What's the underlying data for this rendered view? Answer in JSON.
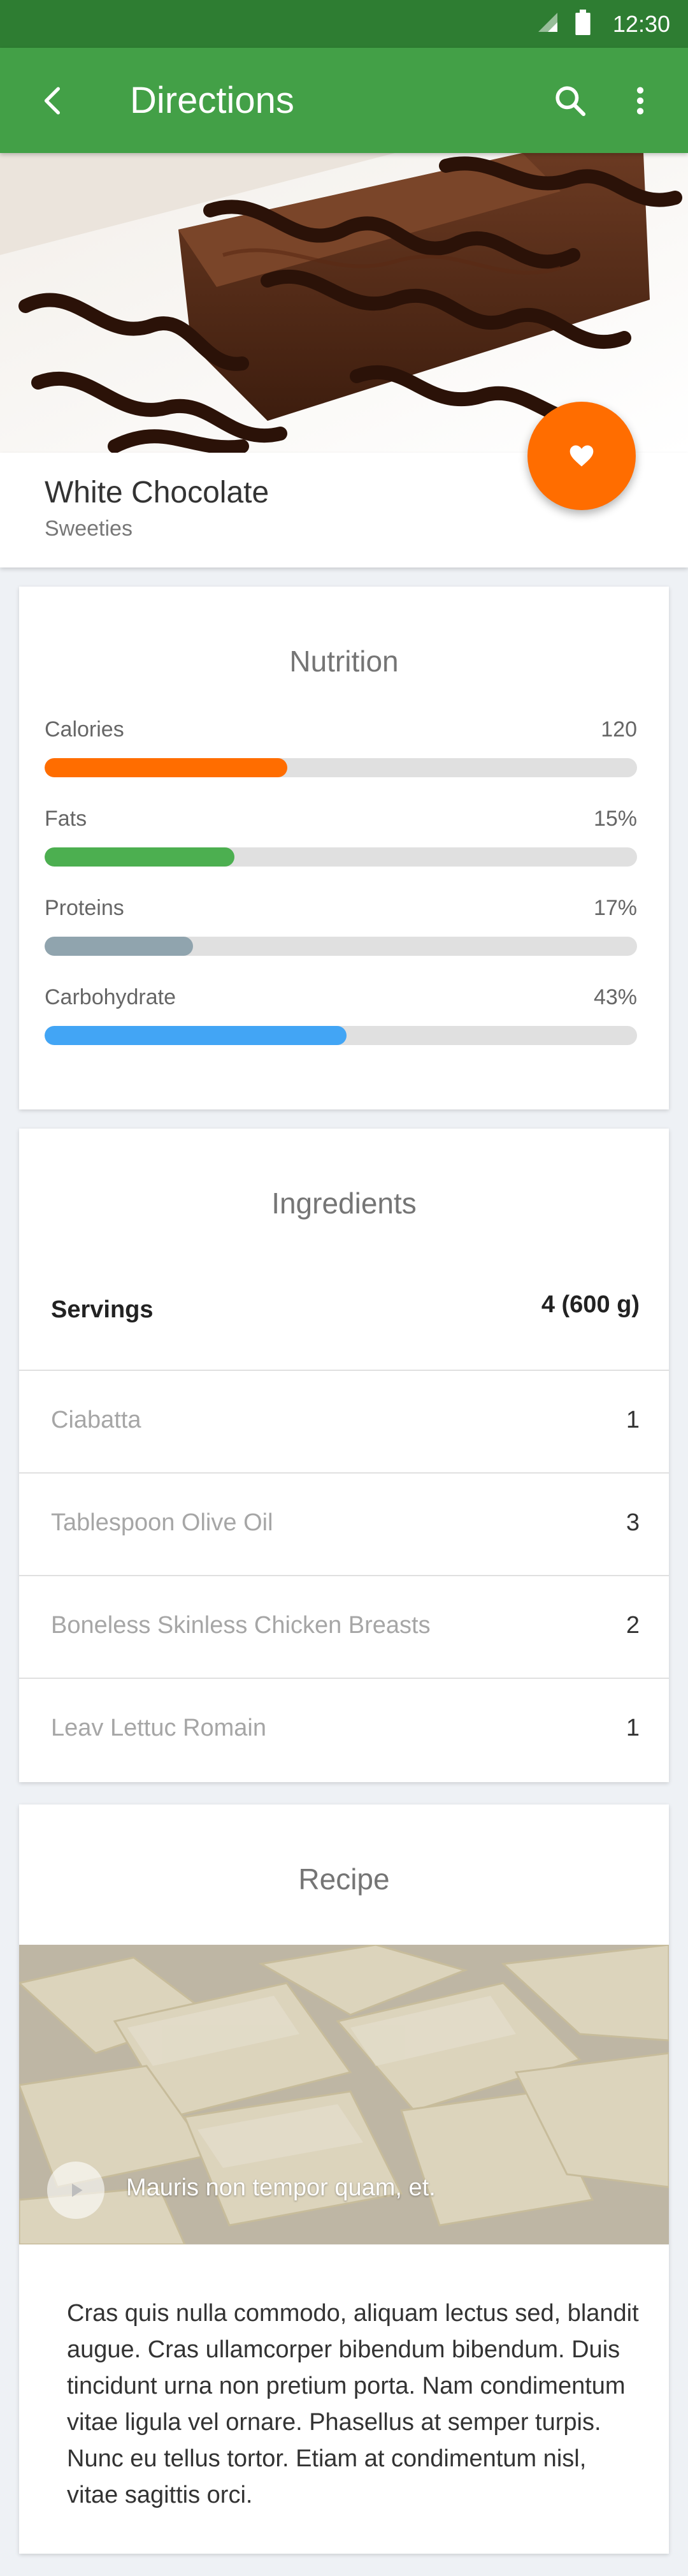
{
  "status_bar": {
    "time": "12:30",
    "signal_icon": "signal-icon",
    "battery_icon": "battery-icon"
  },
  "app_bar": {
    "title": "Directions",
    "back_icon": "arrow-back-icon",
    "search_icon": "search-icon",
    "menu_icon": "more-vert-icon",
    "color": "#43a047"
  },
  "hero": {
    "title": "White Chocolate",
    "subtitle": "Sweeties",
    "favorite_icon": "heart-icon",
    "fab_color": "#ff6d00"
  },
  "nutrition": {
    "title": "Nutrition",
    "items": [
      {
        "label": "Calories",
        "value": "120",
        "progress": 0.41,
        "color": "#ff6d00"
      },
      {
        "label": "Fats",
        "value": "15%",
        "progress": 0.32,
        "color": "#4caf50"
      },
      {
        "label": "Proteins",
        "value": "17%",
        "progress": 0.25,
        "color": "#90a4ae"
      },
      {
        "label": "Carbohydrate",
        "value": "43%",
        "progress": 0.51,
        "color": "#42a5f5"
      }
    ]
  },
  "ingredients": {
    "title": "Ingredients",
    "servings_label": "Servings",
    "servings_value": "4 (600 g)",
    "items": [
      {
        "name": "Ciabatta",
        "qty": "1"
      },
      {
        "name": "Tablespoon Olive Oil",
        "qty": "3"
      },
      {
        "name": "Boneless Skinless Chicken Breasts",
        "qty": "2"
      },
      {
        "name": "Leav Lettuc Romain",
        "qty": "1"
      }
    ]
  },
  "recipe": {
    "title": "Recipe",
    "video_caption": "Mauris non tempor quam, et.",
    "play_icon": "play-icon",
    "body": "Cras quis nulla commodo, aliquam lectus sed, blandit augue. Cras ullamcorper bibendum bibendum. Duis tincidunt urna non pretium porta. Nam condimentum vitae ligula vel ornare. Phasellus at semper turpis. Nunc eu tellus tortor. Etiam at condimentum nisl, vitae sagittis orci."
  }
}
